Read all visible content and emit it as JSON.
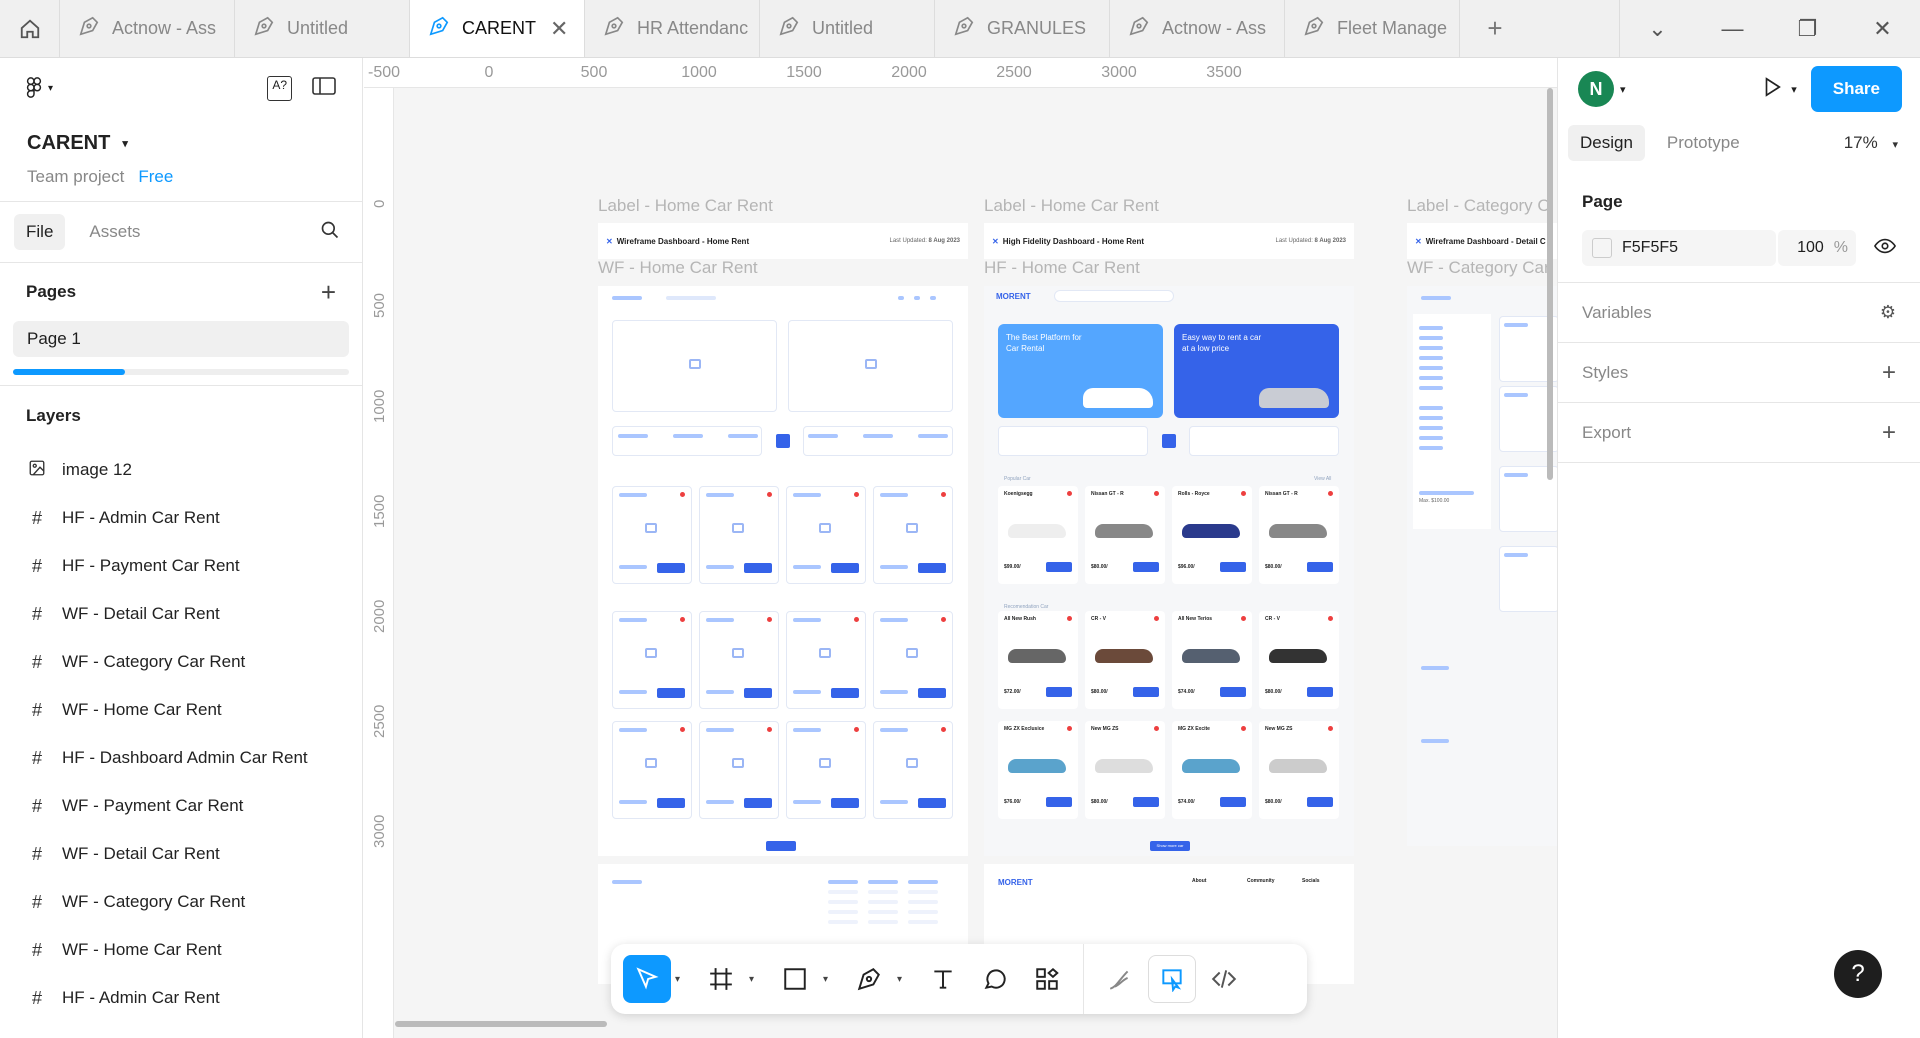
{
  "tabs": [
    {
      "label": "Actnow - Ass",
      "active": false
    },
    {
      "label": "Untitled",
      "active": false
    },
    {
      "label": "CARENT",
      "active": true
    },
    {
      "label": "HR Attendanc",
      "active": false
    },
    {
      "label": "Untitled",
      "active": false
    },
    {
      "label": "GRANULES",
      "active": false
    },
    {
      "label": "Actnow - Ass",
      "active": false
    },
    {
      "label": "Fleet Manage",
      "active": false
    }
  ],
  "project": {
    "name": "CARENT",
    "team": "Team project",
    "plan": "Free"
  },
  "file_tabs": {
    "file": "File",
    "assets": "Assets"
  },
  "pages": {
    "header": "Pages",
    "items": [
      "Page 1"
    ]
  },
  "layers": {
    "header": "Layers",
    "items": [
      {
        "name": "image 12",
        "icon": "image-icon"
      },
      {
        "name": "HF - Admin Car Rent",
        "icon": "frame-icon"
      },
      {
        "name": "HF - Payment Car Rent",
        "icon": "frame-icon"
      },
      {
        "name": "WF - Detail Car Rent",
        "icon": "frame-icon"
      },
      {
        "name": "WF - Category  Car Rent",
        "icon": "frame-icon"
      },
      {
        "name": "WF - Home Car Rent",
        "icon": "frame-icon"
      },
      {
        "name": "HF - Dashboard Admin Car Rent",
        "icon": "frame-icon"
      },
      {
        "name": "WF - Payment  Car Rent",
        "icon": "frame-icon"
      },
      {
        "name": "WF  - Detail Car Rent",
        "icon": "frame-icon"
      },
      {
        "name": "WF - Category Car Rent",
        "icon": "frame-icon"
      },
      {
        "name": "WF - Home Car Rent",
        "icon": "frame-icon"
      },
      {
        "name": "HF - Admin Car Rent",
        "icon": "frame-icon"
      }
    ]
  },
  "ruler_h": [
    "-500",
    "0",
    "500",
    "1000",
    "1500",
    "2000",
    "2500",
    "3000",
    "3500"
  ],
  "ruler_v": [
    "0",
    "500",
    "1000",
    "1500",
    "2000",
    "2500",
    "3000"
  ],
  "canvas": {
    "labels": {
      "l1": "Label - Home Car Rent",
      "l2": "Label - Home Car Rent",
      "l3": "Label - Category  C",
      "f1": "WF - Home Car Rent",
      "f2": "HF - Home Car Rent",
      "f3": "WF - Category Car"
    },
    "headers": {
      "h1": "Wireframe Dashboard - Home Rent",
      "h2": "High Fidelity Dashboard - Home Rent",
      "h3": "Wireframe Dashboard - Detail C",
      "updated": "Last Updated:",
      "date": "8 Aug 2023"
    },
    "hf": {
      "logo": "MORENT",
      "banner1": "The Best Platform for Car Rental",
      "banner2": "Easy way to rent a car at a low price",
      "popular": "Popular Car",
      "recommend": "Recomendation Car",
      "viewall": "View All",
      "cars_row1": [
        "Koenigsegg",
        "Nissan GT - R",
        "Rolls - Royce",
        "Nissan GT - R"
      ],
      "cars_row2": [
        "All New Rush",
        "CR - V",
        "All New Terios",
        "CR - V"
      ],
      "cars_row3": [
        "MG ZX Exclusice",
        "New MG ZS",
        "MG ZX Excite",
        "New MG ZS"
      ],
      "price_a": "$99.00/",
      "price_b": "$80.00/",
      "price_c": "$96.00/",
      "price_d": "$72.00/",
      "price_e": "$74.00/",
      "price_f": "$76.00/",
      "show_more": "Show more car",
      "footer_cols": [
        "About",
        "Community",
        "Socials"
      ]
    },
    "wf3": {
      "max": "Max. $100.00"
    }
  },
  "right": {
    "avatar": "N",
    "share": "Share",
    "design": "Design",
    "prototype": "Prototype",
    "zoom": "17%",
    "page_title": "Page",
    "fill_hex": "F5F5F5",
    "fill_opacity": "100",
    "pct": "%",
    "variables": "Variables",
    "styles": "Styles",
    "export": "Export"
  },
  "help": "?",
  "colors": {
    "accent": "#0d99ff",
    "brand_blue": "#3563e9",
    "canvas_bg": "#f5f5f5"
  }
}
